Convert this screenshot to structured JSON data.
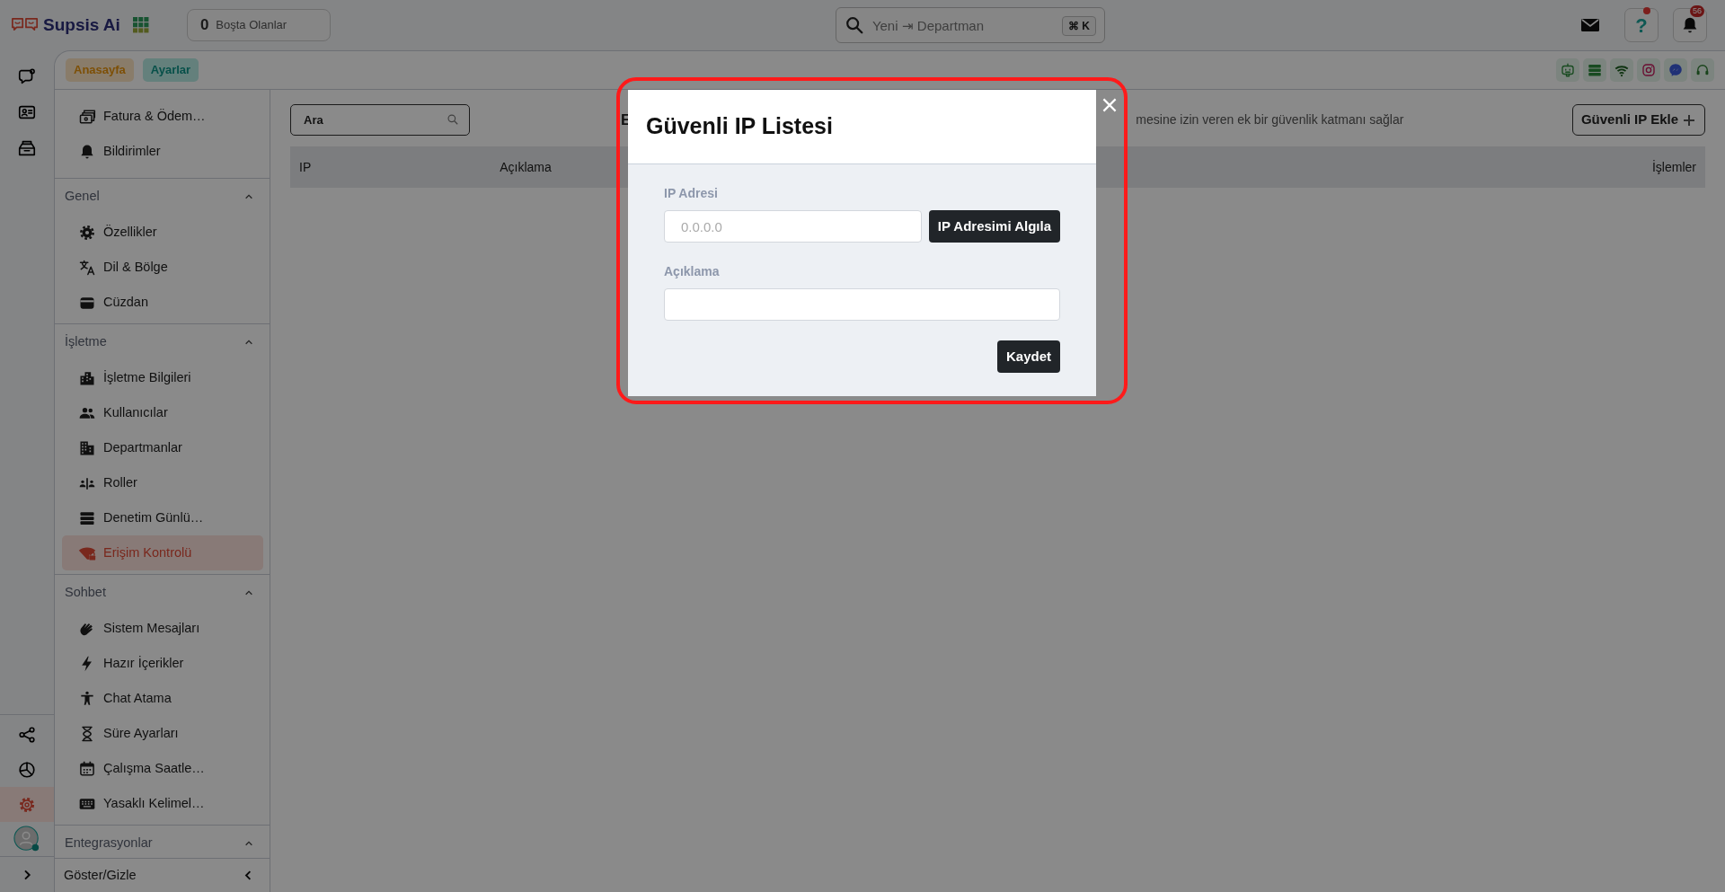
{
  "top_bar": {
    "brand": "Supsis Ai",
    "idle_counter": {
      "count": "0",
      "label": "Boşta Olanlar"
    },
    "search": {
      "placeholder": "Yeni ⇥ Departman",
      "shortcut": "⌘ K"
    },
    "help": {
      "label": "?",
      "alert": true
    },
    "notification_count": "56"
  },
  "rail": {
    "top_items": [
      {
        "kind": "chat",
        "selected": false
      },
      {
        "kind": "idcard",
        "selected": false
      },
      {
        "kind": "inbox",
        "selected": false
      }
    ],
    "bottom_items": [
      {
        "kind": "share",
        "selected": false
      },
      {
        "kind": "pie",
        "selected": false
      },
      {
        "kind": "gear",
        "selected": true
      }
    ],
    "avatar": {
      "online": true
    }
  },
  "breadcrumbs": [
    {
      "label": "Anasayfa",
      "kind": "home"
    },
    {
      "label": "Ayarlar",
      "kind": "settings"
    }
  ],
  "channel_icons": [
    {
      "kind": "robot"
    },
    {
      "kind": "list"
    },
    {
      "kind": "wifi"
    },
    {
      "kind": "camera"
    },
    {
      "kind": "messenger"
    },
    {
      "kind": "headset"
    }
  ],
  "sidebar": {
    "top_items": [
      {
        "label": "Fatura & Ödem…",
        "kind": "bill",
        "selected": false
      },
      {
        "label": "Bildirimler",
        "kind": "bell",
        "selected": false
      }
    ],
    "groups": [
      {
        "title": "Genel",
        "expanded": true,
        "items": [
          {
            "label": "Özellikler",
            "kind": "gear",
            "selected": false
          },
          {
            "label": "Dil & Bölge",
            "kind": "translate",
            "selected": false
          },
          {
            "label": "Cüzdan",
            "kind": "wallet",
            "selected": false
          }
        ]
      },
      {
        "title": "İşletme",
        "expanded": true,
        "items": [
          {
            "label": "İşletme Bilgileri",
            "kind": "buildings",
            "selected": false
          },
          {
            "label": "Kullanıcılar",
            "kind": "people",
            "selected": false
          },
          {
            "label": "Departmanlar",
            "kind": "office",
            "selected": false
          },
          {
            "label": "Roller",
            "kind": "roles",
            "selected": false
          },
          {
            "label": "Denetim Günlü…",
            "kind": "list",
            "selected": false
          },
          {
            "label": "Erişim Kontrolü",
            "kind": "wifilock",
            "selected": true
          }
        ]
      },
      {
        "title": "Sohbet",
        "expanded": true,
        "items": [
          {
            "label": "Sistem Mesajları",
            "kind": "hands",
            "selected": false
          },
          {
            "label": "Hazır İçerikler",
            "kind": "bolt",
            "selected": false
          },
          {
            "label": "Chat Atama",
            "kind": "person",
            "selected": false
          },
          {
            "label": "Süre Ayarları",
            "kind": "hourglass",
            "selected": false
          },
          {
            "label": "Çalışma Saatle…",
            "kind": "calendar",
            "selected": false
          },
          {
            "label": "Yasaklı Kelimel…",
            "kind": "keyboard",
            "selected": false
          }
        ]
      },
      {
        "title": "Entegrasyonlar",
        "expanded": true
      }
    ],
    "footer": {
      "label": "Göster/Gizle"
    }
  },
  "content": {
    "search": {
      "placeholder": "Ara"
    },
    "title_fragment": "E",
    "description_fragment": "mesine izin veren ek bir güvenlik katmanı sağlar",
    "add_button": "Güvenli IP Ekle",
    "table": {
      "columns": [
        "IP",
        "Açıklama",
        "İşlemler"
      ]
    }
  },
  "modal": {
    "title": "Güvenli IP Listesi",
    "fields": [
      {
        "label": "IP Adresi",
        "placeholder": "0.0.0.0",
        "button": "IP Adresimi Algıla"
      },
      {
        "label": "Açıklama"
      }
    ],
    "save_button": "Kaydet"
  }
}
